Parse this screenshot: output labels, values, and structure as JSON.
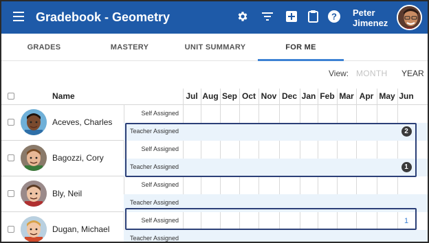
{
  "app": {
    "title": "Gradebook - Geometry",
    "user_first": "Peter",
    "user_last": "Jimenez",
    "icons": [
      "menu-icon",
      "gear-icon",
      "filter-icon",
      "add-icon",
      "clipboard-icon",
      "help-icon"
    ],
    "brand_color": "#1e5aa8"
  },
  "tabs": [
    {
      "label": "GRADES"
    },
    {
      "label": "MASTERY"
    },
    {
      "label": "UNIT SUMMARY"
    },
    {
      "label": "FOR ME",
      "active": true
    }
  ],
  "view": {
    "label": "View:",
    "month": "MONTH",
    "year": "YEAR",
    "selected": "YEAR"
  },
  "table": {
    "name_header": "Name",
    "months": [
      "Jul",
      "Aug",
      "Sep",
      "Oct",
      "Nov",
      "Dec",
      "Jan",
      "Feb",
      "Mar",
      "Apr",
      "May",
      "Jun"
    ],
    "self_label": "Self Assigned",
    "teacher_label": "Teacher Assigned",
    "students": [
      {
        "name": "Aceves, Charles",
        "teacher_count_jun": "2"
      },
      {
        "name": "Bagozzi, Cory",
        "teacher_count_jun": "1"
      },
      {
        "name": "Bly, Neil"
      },
      {
        "name": "Dugan, Michael",
        "self_count_jun": "1"
      }
    ]
  }
}
